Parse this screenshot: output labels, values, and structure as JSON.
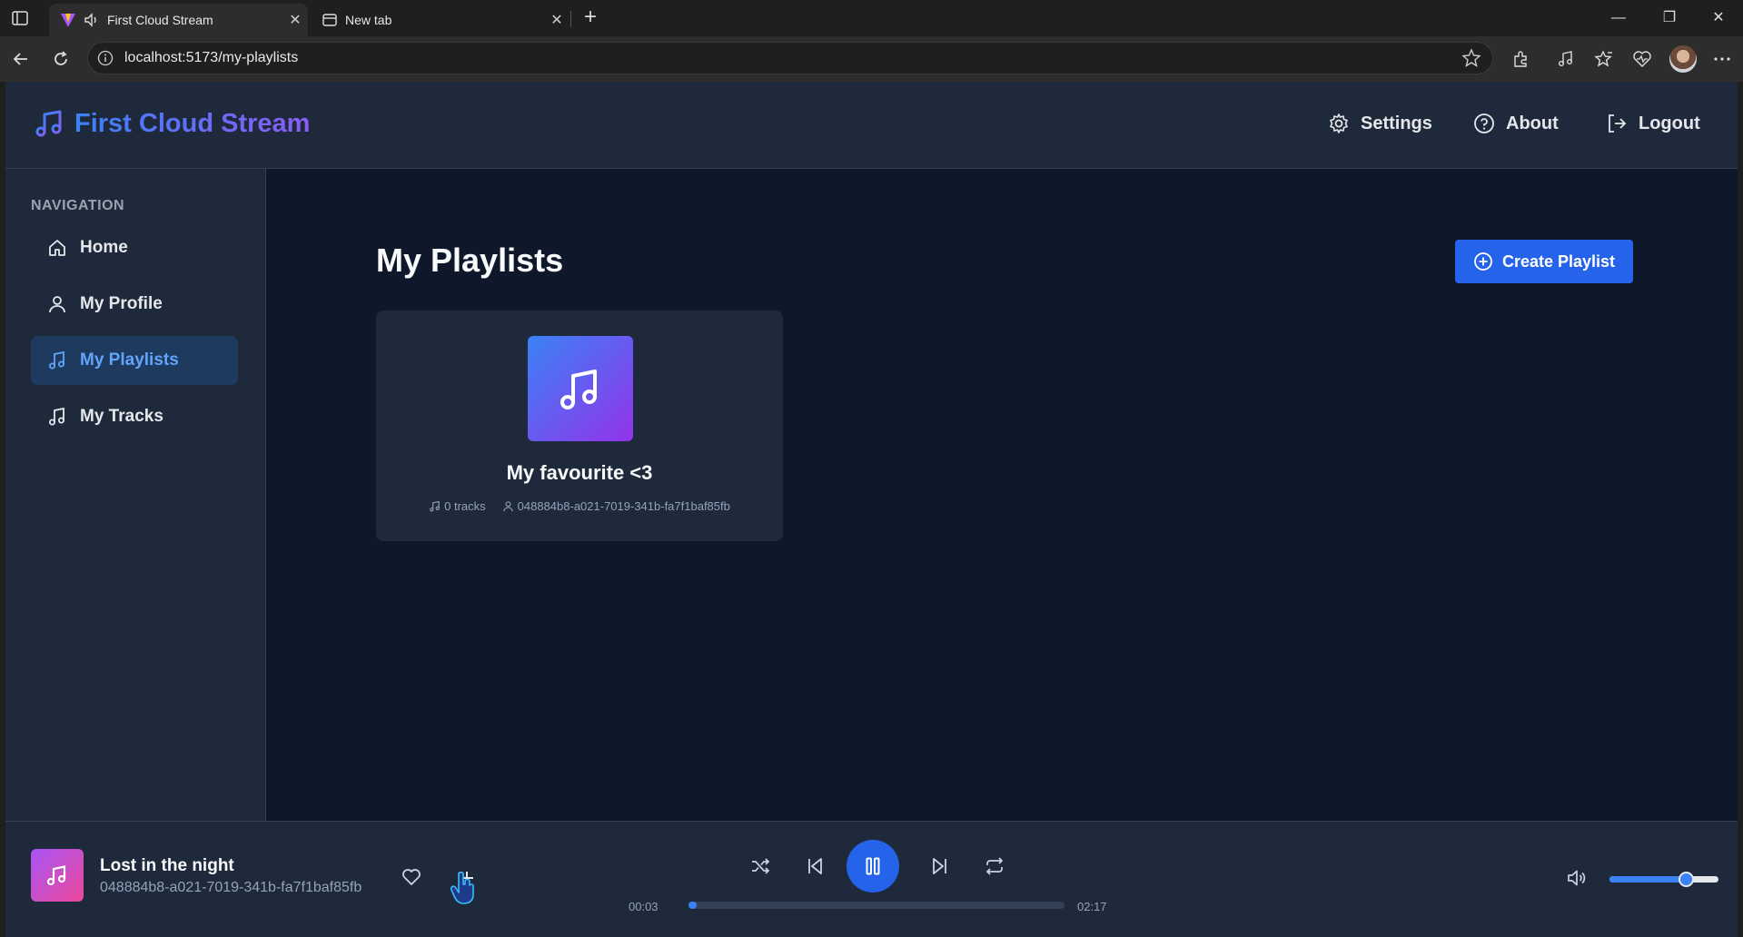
{
  "browser": {
    "tabs": [
      {
        "title": "First Cloud Stream",
        "active": true
      },
      {
        "title": "New tab",
        "active": false
      }
    ],
    "url": "localhost:5173/my-playlists"
  },
  "header": {
    "app_name": "First Cloud Stream",
    "links": [
      {
        "label": "Settings",
        "icon": "gear-icon"
      },
      {
        "label": "About",
        "icon": "help-circle-icon"
      },
      {
        "label": "Logout",
        "icon": "logout-icon"
      }
    ]
  },
  "sidebar": {
    "heading": "NAVIGATION",
    "items": [
      {
        "label": "Home",
        "icon": "home-icon",
        "active": false
      },
      {
        "label": "My Profile",
        "icon": "user-icon",
        "active": false
      },
      {
        "label": "My Playlists",
        "icon": "music-note-icon",
        "active": true
      },
      {
        "label": "My Tracks",
        "icon": "music-note-icon",
        "active": false
      }
    ]
  },
  "main": {
    "title": "My Playlists",
    "create_button": "Create Playlist",
    "playlists": [
      {
        "name": "My favourite <3",
        "tracks": "0 tracks",
        "owner": "048884b8-a021-7019-341b-fa7f1baf85fb"
      }
    ]
  },
  "player": {
    "title": "Lost in the night",
    "artist": "048884b8-a021-7019-341b-fa7f1baf85fb",
    "current_time": "00:03",
    "duration": "02:17",
    "progress_fraction": 0.022,
    "volume_fraction": 0.7,
    "is_playing": true
  },
  "colors": {
    "accent": "#2563eb",
    "app_bg": "#0f172a",
    "panel_bg": "#1e293b",
    "active_nav": "#60a5fa"
  }
}
